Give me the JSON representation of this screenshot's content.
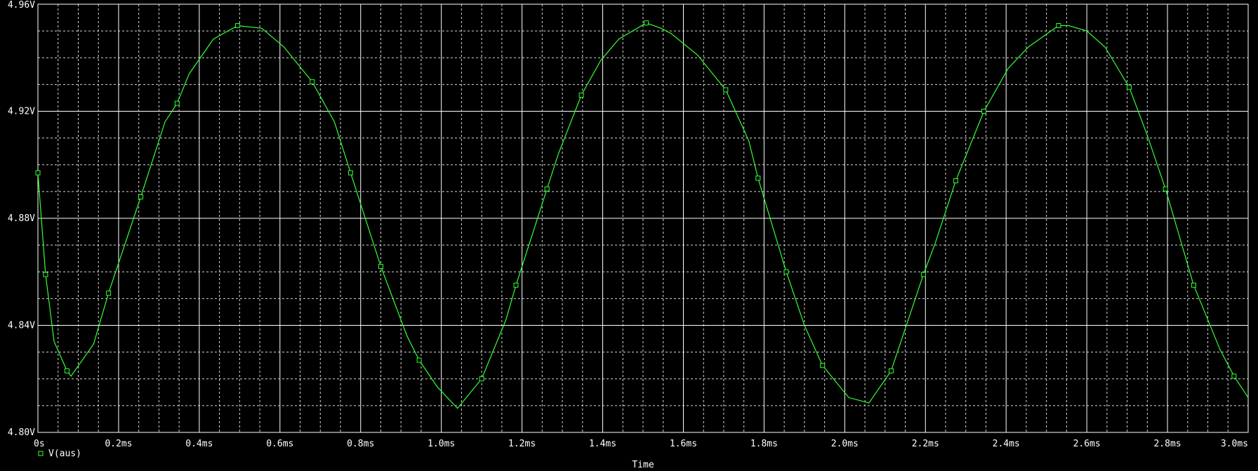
{
  "chart_data": {
    "type": "line",
    "xlabel": "Time",
    "ylabel": "",
    "xlim": [
      0,
      3.0
    ],
    "ylim": [
      4.8,
      4.96
    ],
    "grid": true,
    "legend_placement": "bottom-left",
    "x_ticks": [
      {
        "v": 0.0,
        "label": "0s"
      },
      {
        "v": 0.2,
        "label": "0.2ms"
      },
      {
        "v": 0.4,
        "label": "0.4ms"
      },
      {
        "v": 0.6,
        "label": "0.6ms"
      },
      {
        "v": 0.8,
        "label": "0.8ms"
      },
      {
        "v": 1.0,
        "label": "1.0ms"
      },
      {
        "v": 1.2,
        "label": "1.2ms"
      },
      {
        "v": 1.4,
        "label": "1.4ms"
      },
      {
        "v": 1.6,
        "label": "1.6ms"
      },
      {
        "v": 1.8,
        "label": "1.8ms"
      },
      {
        "v": 2.0,
        "label": "2.0ms"
      },
      {
        "v": 2.2,
        "label": "2.2ms"
      },
      {
        "v": 2.4,
        "label": "2.4ms"
      },
      {
        "v": 2.6,
        "label": "2.6ms"
      },
      {
        "v": 2.8,
        "label": "2.8ms"
      },
      {
        "v": 3.0,
        "label": "3.0ms"
      }
    ],
    "y_ticks": [
      {
        "v": 4.8,
        "label": "4.80V"
      },
      {
        "v": 4.84,
        "label": "4.84V"
      },
      {
        "v": 4.88,
        "label": "4.88V"
      },
      {
        "v": 4.92,
        "label": "4.92V"
      },
      {
        "v": 4.96,
        "label": "4.96V"
      }
    ],
    "series": [
      {
        "name": "V(aus)",
        "color": "#33ff33",
        "x": [
          0.0,
          0.019,
          0.04,
          0.072,
          0.082,
          0.138,
          0.175,
          0.255,
          0.315,
          0.345,
          0.375,
          0.435,
          0.495,
          0.555,
          0.61,
          0.68,
          0.735,
          0.775,
          0.85,
          0.915,
          0.945,
          0.99,
          1.04,
          1.1,
          1.16,
          1.185,
          1.262,
          1.29,
          1.347,
          1.395,
          1.44,
          1.508,
          1.545,
          1.57,
          1.635,
          1.705,
          1.762,
          1.785,
          1.855,
          1.9,
          1.945,
          2.01,
          2.06,
          2.115,
          2.195,
          2.225,
          2.275,
          2.345,
          2.405,
          2.455,
          2.53,
          2.555,
          2.6,
          2.645,
          2.705,
          2.75,
          2.795,
          2.865,
          2.93,
          2.965,
          3.0
        ],
        "y": [
          4.897,
          4.859,
          4.834,
          4.823,
          4.821,
          4.833,
          4.852,
          4.888,
          4.916,
          4.923,
          4.934,
          4.947,
          4.952,
          4.951,
          4.944,
          4.931,
          4.916,
          4.897,
          4.862,
          4.836,
          4.827,
          4.817,
          4.809,
          4.82,
          4.842,
          4.855,
          4.891,
          4.904,
          4.926,
          4.939,
          4.947,
          4.953,
          4.951,
          4.949,
          4.941,
          4.928,
          4.909,
          4.895,
          4.86,
          4.84,
          4.825,
          4.813,
          4.811,
          4.823,
          4.859,
          4.871,
          4.894,
          4.92,
          4.936,
          4.944,
          4.952,
          4.952,
          4.95,
          4.944,
          4.929,
          4.911,
          4.891,
          4.855,
          4.831,
          4.821,
          4.813
        ],
        "marker_x": [
          0.0,
          0.019,
          0.072,
          0.175,
          0.255,
          0.345,
          0.495,
          0.68,
          0.775,
          0.85,
          0.945,
          1.1,
          1.185,
          1.262,
          1.347,
          1.508,
          1.705,
          1.785,
          1.855,
          1.945,
          2.115,
          2.195,
          2.275,
          2.345,
          2.53,
          2.705,
          2.795,
          2.865,
          2.965
        ],
        "marker_y": [
          4.897,
          4.859,
          4.823,
          4.852,
          4.888,
          4.923,
          4.952,
          4.931,
          4.897,
          4.862,
          4.827,
          4.82,
          4.855,
          4.891,
          4.926,
          4.953,
          4.928,
          4.895,
          4.86,
          4.825,
          4.823,
          4.859,
          4.894,
          4.92,
          4.952,
          4.929,
          4.891,
          4.855,
          4.821
        ]
      }
    ]
  }
}
